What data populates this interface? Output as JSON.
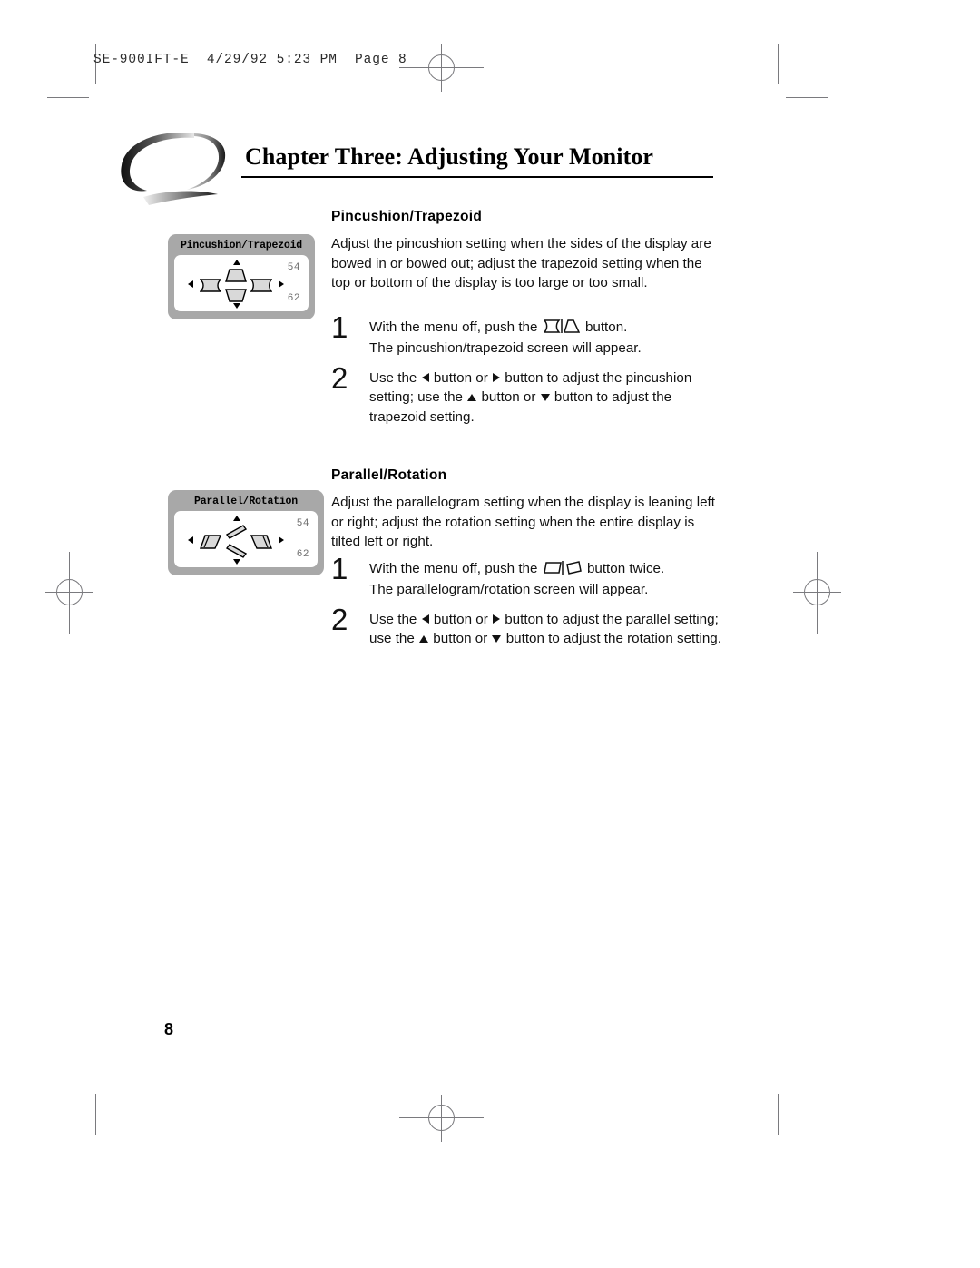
{
  "film_header": {
    "text": "SE-900IFT-E  4/29/92 5:23 PM  Page 8"
  },
  "chapter": {
    "title": "Chapter Three: Adjusting Your Monitor",
    "logo_name": "swoosh-logo"
  },
  "sections": [
    {
      "heading": "Pincushion/Trapezoid",
      "paragraph": "Adjust the pincushion setting when the sides of the display are bowed in or bowed out; adjust the trapezoid setting when the top or bottom of the display is too large or too small.",
      "osd": {
        "title": "Pincushion/Trapezoid",
        "value_top": "54",
        "value_bottom": "62",
        "icon_up": "trapezoid-top-narrow-icon",
        "icon_down": "trapezoid-bottom-narrow-icon",
        "icon_left": "pincushion-in-icon",
        "icon_right": "pincushion-out-icon"
      },
      "steps": [
        {
          "number": "1",
          "text_before_glyph": "With the menu off, push the",
          "glyph": "pincushion-trapezoid-button-icon",
          "text_after_glyph": "button.",
          "line2": "The pincushion/trapezoid screen will appear."
        },
        {
          "number": "2",
          "part1": "Use the",
          "part2": "button or",
          "part3": "button to adjust the pincushion setting; use the",
          "part4": "button or",
          "part5": "button to adjust the trapezoid setting."
        }
      ]
    },
    {
      "heading": "Parallel/Rotation",
      "paragraph": "Adjust the parallelogram setting when the display is leaning left or right; adjust the rotation setting when the entire display is tilted left or right.",
      "osd": {
        "title": "Parallel/Rotation",
        "value_top": "54",
        "value_bottom": "62",
        "icon_up": "rotation-clockwise-icon",
        "icon_down": "rotation-counterclockwise-icon",
        "icon_left": "parallelogram-left-icon",
        "icon_right": "parallelogram-right-icon"
      },
      "steps": [
        {
          "number": "1",
          "text_before_glyph": "With the menu off, push the",
          "glyph": "parallel-rotation-button-icon",
          "text_after_glyph": "button twice.",
          "line2": "The parallelogram/rotation screen will appear."
        },
        {
          "number": "2",
          "part1": "Use the",
          "part2": "button or",
          "part3": "button to adjust the parallel setting; use the",
          "part4": "button or",
          "part5": "button to adjust the rotation setting."
        }
      ]
    }
  ],
  "folio": {
    "page_number": "8"
  },
  "colors": {
    "osd_frame": "#a8a8a8",
    "osd_screen": "#ffffff",
    "osd_value_text": "#6d6d6d",
    "mark_gray": "#7a7a7e",
    "text": "#111111"
  }
}
